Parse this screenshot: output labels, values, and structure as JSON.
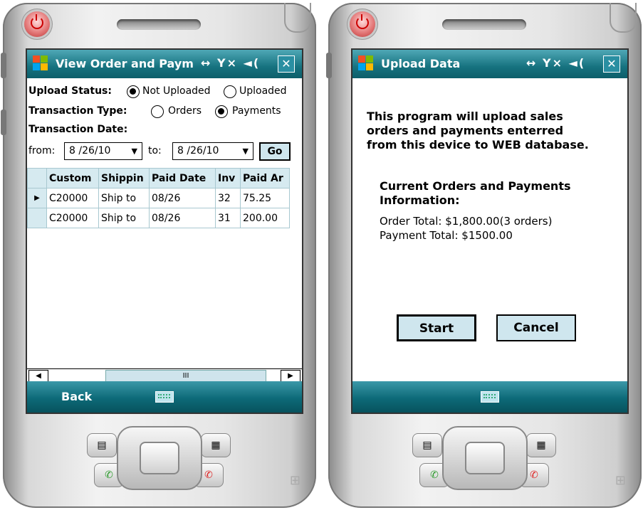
{
  "left": {
    "title": "View Order and Paym",
    "status_icons": "↔ Y× ◄(",
    "close_glyph": "✕",
    "upload_status_label": "Upload Status:",
    "radio_not_uploaded": "Not Uploaded",
    "radio_uploaded": "Uploaded",
    "transaction_type_label": "Transaction Type:",
    "radio_orders": "Orders",
    "radio_payments": "Payments",
    "transaction_date_label": "Transaction Date:",
    "from_label": "from:",
    "from_value": "8 /26/10",
    "to_label": "to:",
    "to_value": "8 /26/10",
    "go_label": "Go",
    "columns": [
      "Custom",
      "Shippin",
      "Paid Date",
      "Inv",
      "Paid Ar"
    ],
    "rows": [
      [
        "C20000",
        "Ship to",
        "08/26",
        "32",
        "75.25"
      ],
      [
        "C20000",
        "Ship to",
        "08/26",
        "31",
        "200.00"
      ]
    ],
    "row_indicator": "▶",
    "scroll_left": "◀",
    "scroll_right": "▶",
    "scroll_thumb": "III",
    "soft_left": "Back",
    "selected_upload_status": "Not Uploaded",
    "selected_transaction_type": "Payments"
  },
  "right": {
    "title": "Upload Data",
    "status_icons": "↔ Y× ◄(",
    "close_glyph": "✕",
    "message_line1": "This program will upload sales",
    "message_line2": "orders and payments enterred",
    "message_line3": "from this device to WEB database.",
    "info_heading_line1": "Current Orders and Payments",
    "info_heading_line2": "Information:",
    "order_total": "Order Total: $1,800.00(3 orders)",
    "payment_total": "Payment Total: $1500.00",
    "start_label": "Start",
    "cancel_label": "Cancel"
  },
  "hardware": {
    "start_key_glyph": "▤",
    "grid_key_glyph": "▦",
    "call_glyph": "✆",
    "end_glyph": "✆",
    "windows_flag": "⊞",
    "dpad_up": "▲",
    "dpad_down": "▼",
    "dpad_left": "◀",
    "dpad_right": "▶"
  },
  "colors": {
    "titlebar": "#16727f",
    "grid_header": "#d6eaf0",
    "button_fill": "#cfe6ee"
  }
}
